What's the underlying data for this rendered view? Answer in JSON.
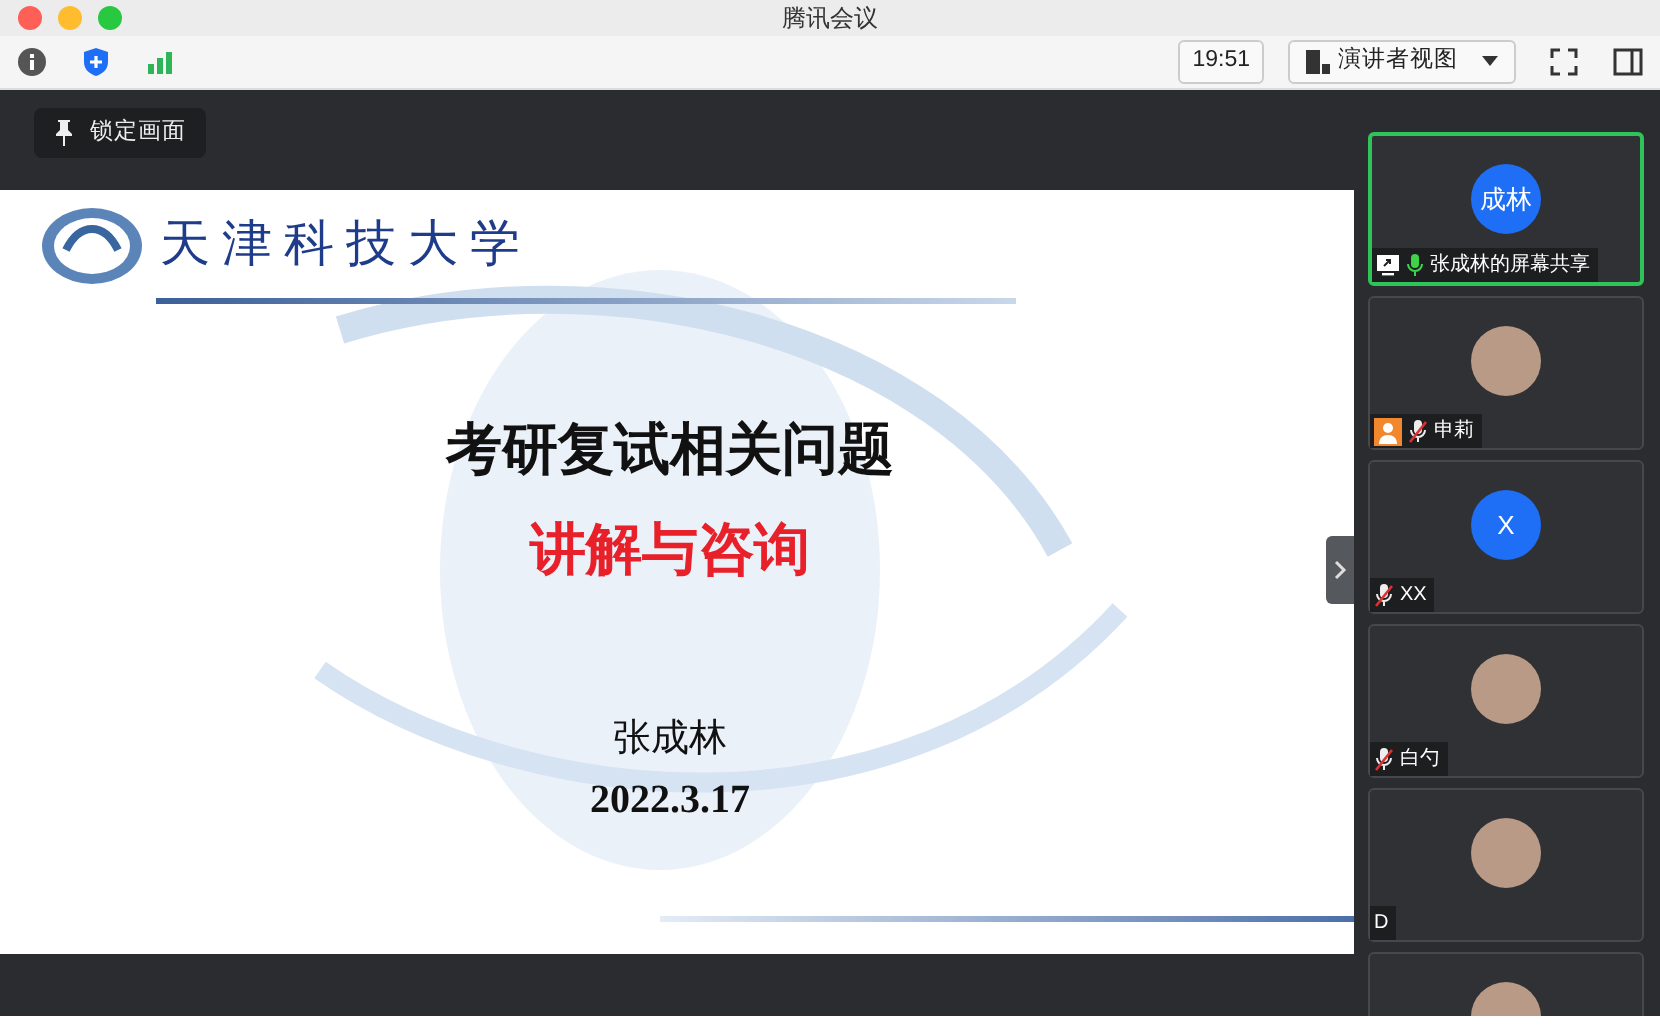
{
  "window": {
    "title": "腾讯会议"
  },
  "toolbar": {
    "time": "19:51",
    "view_label": "演讲者视图"
  },
  "lock_button": {
    "label": "锁定画面"
  },
  "slide": {
    "school": "天津科技大学",
    "title": "考研复试相关问题",
    "subtitle": "讲解与咨询",
    "presenter": "张成林",
    "date": "2022.3.17"
  },
  "participants": [
    {
      "name": "张成林的屏幕共享",
      "avatar_text": "成林",
      "photo": false,
      "mic_on": true,
      "mic_muted": false,
      "screen_share": true,
      "person_badge": false,
      "selected": true
    },
    {
      "name": "申莉",
      "photo": true,
      "mic_on": false,
      "mic_muted": true,
      "screen_share": false,
      "person_badge": true,
      "selected": false
    },
    {
      "name": "XX",
      "avatar_text": "X",
      "photo": false,
      "mic_on": false,
      "mic_muted": true,
      "screen_share": false,
      "person_badge": false,
      "selected": false
    },
    {
      "name": "白勺",
      "photo": true,
      "mic_on": false,
      "mic_muted": true,
      "screen_share": false,
      "person_badge": false,
      "selected": false
    },
    {
      "name": "D",
      "photo": true,
      "mic_on": false,
      "mic_muted": false,
      "screen_share": false,
      "person_badge": false,
      "selected": false
    },
    {
      "photo": true,
      "mic_on": false,
      "mic_muted": false,
      "screen_share": false,
      "person_badge": false,
      "selected": false
    }
  ]
}
